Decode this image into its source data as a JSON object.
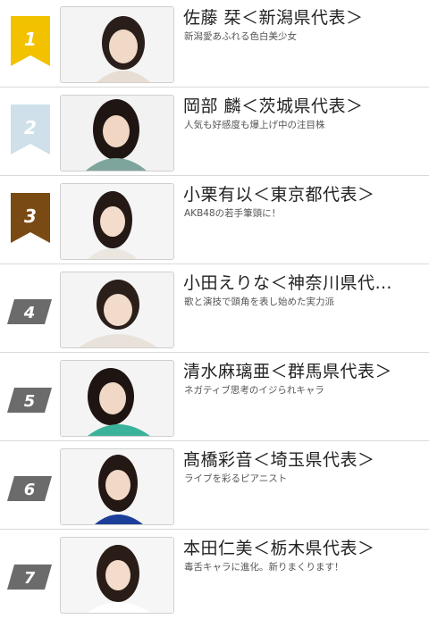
{
  "members": [
    {
      "rank": "1",
      "name": "佐藤 栞＜新潟県代表＞",
      "desc": "新潟愛あふれる色白美少女",
      "badge_color": "#f2c200"
    },
    {
      "rank": "2",
      "name": "岡部 麟＜茨城県代表＞",
      "desc": "人気も好感度も爆上げ中の注目株",
      "badge_color": "#cfe0ea"
    },
    {
      "rank": "3",
      "name": "小栗有以＜東京都代表＞",
      "desc": "AKB48の若手筆頭に！",
      "badge_color": "#7a4a14"
    },
    {
      "rank": "4",
      "name": "小田えりな＜神奈川県代…",
      "desc": "歌と演技で頭角を表し始めた実力派",
      "badge_color": "#6b6b6b"
    },
    {
      "rank": "5",
      "name": "清水麻璃亜＜群馬県代表＞",
      "desc": "ネガティブ思考のイジられキャラ",
      "badge_color": "#6b6b6b"
    },
    {
      "rank": "6",
      "name": "髙橋彩音＜埼玉県代表＞",
      "desc": "ライブを彩るピアニスト",
      "badge_color": "#6b6b6b"
    },
    {
      "rank": "7",
      "name": "本田仁美＜栃木県代表＞",
      "desc": "毒舌キャラに進化。新りまくります！",
      "badge_color": "#6b6b6b"
    }
  ]
}
